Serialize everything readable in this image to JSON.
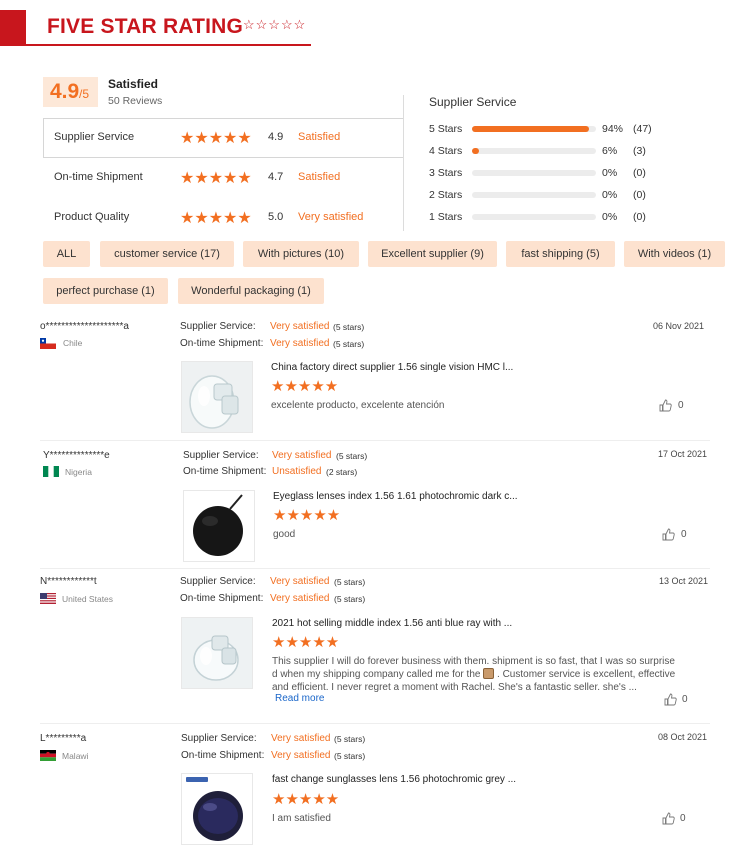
{
  "header": {
    "title": "FIVE STAR RATING",
    "stars": "☆☆☆☆☆"
  },
  "summary": {
    "score": "4.9",
    "score_suffix": "/5",
    "label": "Satisfied",
    "reviews": "50 Reviews",
    "metrics": [
      {
        "label": "Supplier Service",
        "stars": "★★★★★",
        "score": "4.9",
        "word": "Satisfied"
      },
      {
        "label": "On-time Shipment",
        "stars": "★★★★★",
        "score": "4.7",
        "word": "Satisfied"
      },
      {
        "label": "Product Quality",
        "stars": "★★★★★",
        "score": "5.0",
        "word": "Very satisfied"
      }
    ]
  },
  "distribution": {
    "title": "Supplier Service",
    "rows": [
      {
        "label": "5 Stars",
        "fraction": 0.94,
        "pct": "94%",
        "count": "(47)"
      },
      {
        "label": "4 Stars",
        "fraction": 0.06,
        "pct": "6%",
        "count": "(3)"
      },
      {
        "label": "3 Stars",
        "fraction": 0,
        "pct": "0%",
        "count": "(0)"
      },
      {
        "label": "2 Stars",
        "fraction": 0,
        "pct": "0%",
        "count": "(0)"
      },
      {
        "label": "1 Stars",
        "fraction": 0,
        "pct": "0%",
        "count": "(0)"
      }
    ]
  },
  "tags": [
    "ALL",
    "customer service (17)",
    "With pictures (10)",
    "Excellent supplier (9)",
    "fast shipping (5)",
    "With videos (1)",
    "perfect purchase (1)",
    "Wonderful packaging (1)"
  ],
  "review_labels": {
    "service": "Supplier Service:",
    "shipment": "On-time Shipment:"
  },
  "reviews": [
    {
      "name": "o********************a",
      "country": "Chile",
      "service": "Very satisfied",
      "service_note": "(5 stars)",
      "shipment": "Very satisfied",
      "shipment_note": "(5 stars)",
      "date": "06 Nov 2021",
      "product": "China factory direct supplier 1.56 single vision HMC l...",
      "stars": "★★★★★",
      "text": "excelente producto, excelente atención",
      "likes": "0"
    },
    {
      "name": "Y**************e",
      "country": "Nigeria",
      "service": "Very satisfied",
      "service_note": "(5 stars)",
      "shipment": "Unsatisfied",
      "shipment_note": "(2 stars)",
      "date": "17 Oct 2021",
      "product": "Eyeglass lenses index 1.56 1.61 photochromic dark c...",
      "stars": "★★★★★",
      "text": "good",
      "likes": "0"
    },
    {
      "name": "N************t",
      "country": "United States",
      "service": "Very satisfied",
      "service_note": "(5 stars)",
      "shipment": "Very satisfied",
      "shipment_note": "(5 stars)",
      "date": "13 Oct 2021",
      "product": "2021 hot selling middle index 1.56 anti blue ray with ...",
      "stars": "★★★★★",
      "text_lines": [
        "This supplier I will do forever business with them. shipment is so fast, that I was so surprise",
        "d when my shipping company called me for the",
        ". Customer service is excellent, effective",
        "and efficient. I never regret a moment with Rachel. She's a fantastic seller. she's ..."
      ],
      "read_more": "Read more",
      "likes": "0"
    },
    {
      "name": "L*********a",
      "country": "Malawi",
      "service": "Very satisfied",
      "service_note": "(5 stars)",
      "shipment": "Very satisfied",
      "shipment_note": "(5 stars)",
      "date": "08 Oct 2021",
      "product": "fast change sunglasses lens 1.56 photochromic grey ...",
      "stars": "★★★★★",
      "text": "I am satisfied",
      "likes": "0"
    }
  ],
  "colors": {
    "accent": "#f26f21",
    "brand_red": "#c8161d",
    "tag_bg": "#fde2cf",
    "link": "#1a66c9"
  }
}
